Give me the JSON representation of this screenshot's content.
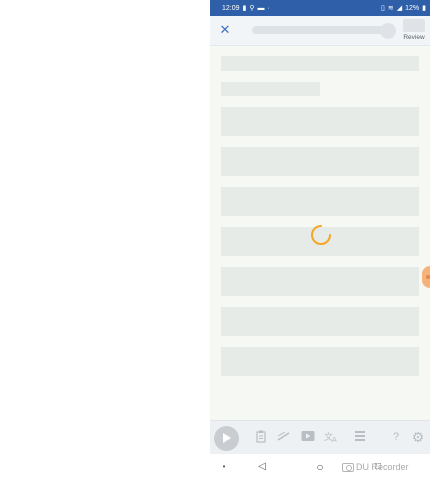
{
  "status_bar": {
    "time": "12:09",
    "battery": "12%",
    "left_icons": [
      "battery-saver-icon",
      "location-icon",
      "cast-icon",
      "more-dots-icon"
    ],
    "right_icons": [
      "vibrate-icon",
      "network-icon",
      "signal-icon",
      "battery-icon"
    ]
  },
  "toolbar": {
    "close_glyph": "✕",
    "review_label": "Review"
  },
  "skeleton_rows": 8,
  "bottom_toolbar": {
    "icons": [
      "play-icon",
      "note-icon",
      "highlight-icon",
      "video-icon",
      "translate-icon",
      "menu-icon",
      "help-icon",
      "settings-icon"
    ],
    "help_glyph": "?",
    "settings_glyph": "⚙"
  },
  "nav_bar": {
    "dot": "•",
    "back": "◁",
    "home": "○",
    "recent": "□"
  },
  "watermark": {
    "text": "DU Recorder"
  },
  "colors": {
    "status_bar": "#2f5fa8",
    "accent": "#3d73c4",
    "spinner": "#f5a623"
  }
}
